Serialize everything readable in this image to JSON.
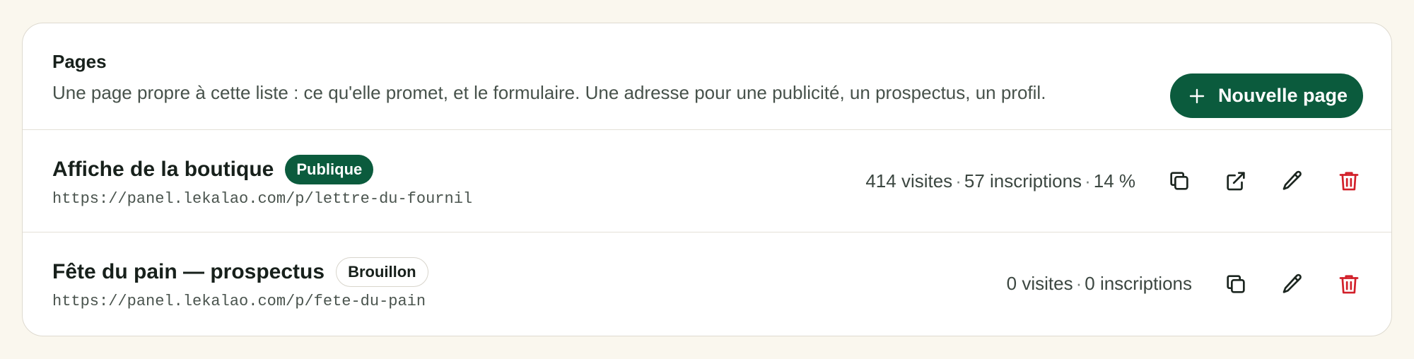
{
  "header": {
    "title": "Pages",
    "description": "Une page propre à cette liste : ce qu'elle promet, et le formulaire. Une adresse pour une publicité, un prospectus, un profil.",
    "new_button_label": "Nouvelle page",
    "new_button_icon": "plus-icon"
  },
  "colors": {
    "accent": "#0b5b3d",
    "danger": "#d2202a"
  },
  "pages": [
    {
      "name": "Affiche de la boutique",
      "status": "Publique",
      "url": "https://panel.lekalao.com/p/lettre-du-fournil",
      "visits": "414 visites",
      "signups": "57 inscriptions",
      "rate": "14 %",
      "actions": [
        "copy-icon",
        "external-link-icon",
        "pencil-icon",
        "trash-icon"
      ]
    },
    {
      "name": "Fête du pain — prospectus",
      "status": "Brouillon",
      "url": "https://panel.lekalao.com/p/fete-du-pain",
      "visits": "0 visites",
      "signups": "0 inscriptions",
      "actions": [
        "copy-icon",
        "pencil-icon",
        "trash-icon"
      ]
    }
  ]
}
